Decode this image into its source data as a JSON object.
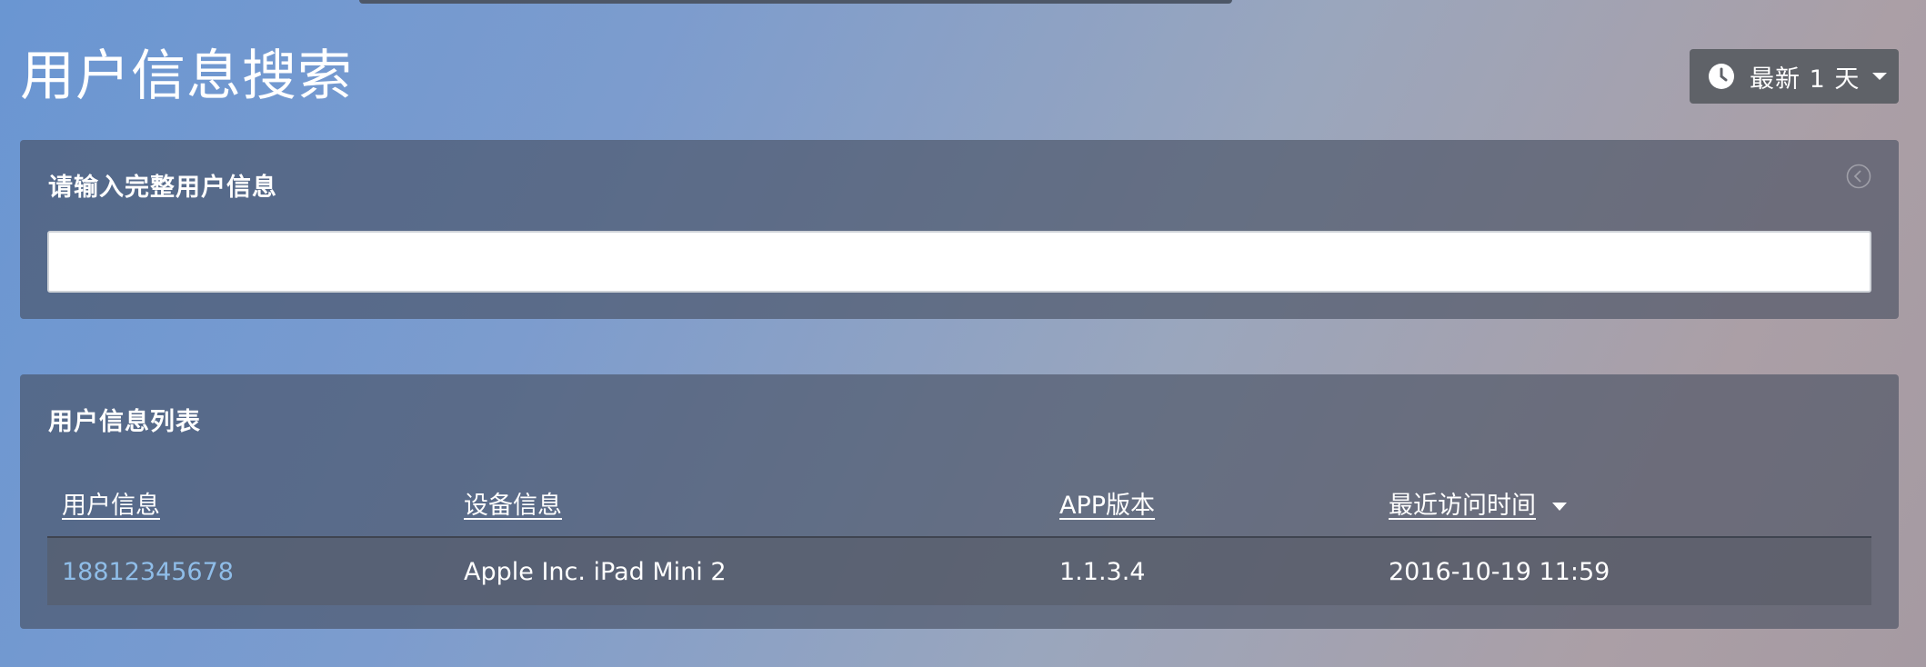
{
  "header": {
    "page_title": "用户信息搜索",
    "time_range_label": "最新 1 天"
  },
  "search_panel": {
    "heading": "请输入完整用户信息",
    "input_value": "",
    "input_placeholder": ""
  },
  "list_panel": {
    "heading": "用户信息列表",
    "columns": [
      "用户信息",
      "设备信息",
      "APP版本",
      "最近访问时间"
    ],
    "sorted_column": "最近访问时间",
    "sort_direction": "descending",
    "rows": [
      {
        "user": "18812345678",
        "device": "Apple Inc. iPad Mini 2",
        "app_version": "1.1.3.4",
        "last_visit": "2016-10-19 11:59"
      }
    ]
  },
  "icons": {
    "time_range": "clock-icon",
    "collapse": "chevron-left-circle-icon",
    "sort": "caret-down-icon"
  },
  "colors": {
    "link": "#8fbde8",
    "panel_bg": "#464e5f",
    "button_bg": "#5f6268"
  }
}
